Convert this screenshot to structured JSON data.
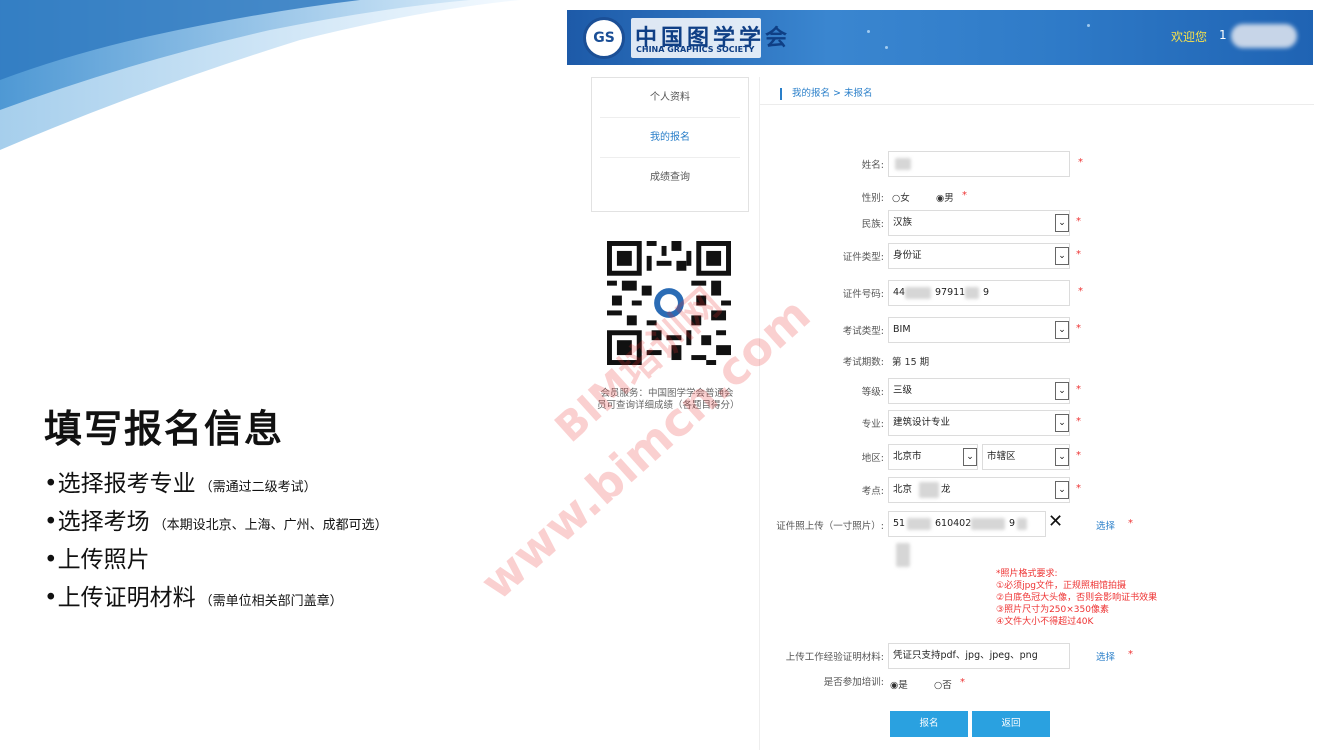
{
  "slide": {
    "title": "填写报名信息",
    "bullets": [
      {
        "text": "•选择报考专业",
        "note": "（需通过二级考试）"
      },
      {
        "text": "•选择考场",
        "note": "（本期设北京、上海、广州、成都可选）"
      },
      {
        "text": "•上传照片",
        "note": ""
      },
      {
        "text": "•上传证明材料",
        "note": "（需单位相关部门盖章）"
      }
    ]
  },
  "header": {
    "logo_cn": "中国图学学会",
    "logo_en": "CHINA GRAPHICS SOCIETY",
    "welcome": "欢迎您",
    "user_num": "1"
  },
  "sidebar": {
    "items": [
      "个人资料",
      "我的报名",
      "成绩查询"
    ],
    "qr_caption": "会员服务：中国图学学会普通会员可查询详细成绩（各题目得分）"
  },
  "breadcrumb": "我的报名 > 未报名",
  "form": {
    "name_label": "姓名:",
    "gender_label": "性别:",
    "gender_female": "○女",
    "gender_male": "◉男",
    "ethnic_label": "民族:",
    "ethnic_value": "汉族",
    "idtype_label": "证件类型:",
    "idtype_value": "身份证",
    "idnum_label": "证件号码:",
    "idnum_a": "44",
    "idnum_b": "97911",
    "idnum_c": "9",
    "examtype_label": "考试类型:",
    "examtype_value": "BIM",
    "period_label": "考试期数:",
    "period_value": "第 15 期",
    "level_label": "等级:",
    "level_value": "三级",
    "major_label": "专业:",
    "major_value": "建筑设计专业",
    "region_label": "地区:",
    "region_city": "北京市",
    "region_district": "市辖区",
    "site_label": "考点:",
    "site_a": "北京",
    "site_b": "龙",
    "photo_label": "证件照上传（一寸照片）:",
    "photo_a": "51",
    "photo_b": "610402",
    "photo_c": "9",
    "photo_clear": "✕",
    "select_label": "选择",
    "photo_req": [
      "*照片格式要求:",
      "①必须jpg文件，正规照相馆拍摄",
      "②白底色冠大头像，否则会影响证书效果",
      "③照片尺寸为250×350像素",
      "④文件大小不得超过40K"
    ],
    "proof_label": "上传工作经验证明材料:",
    "proof_hint": "凭证只支持pdf、jpg、jpeg、png",
    "train_label": "是否参加培训:",
    "train_yes": "◉是",
    "train_no": "○否",
    "star": "*",
    "submit": "报名",
    "back": "返回"
  },
  "watermark": {
    "line1": "BIM培训网",
    "line2": "www.bimcn.com"
  },
  "colors": {
    "accent": "#2a7fc9",
    "button": "#2aa1e0",
    "required": "#ee3333",
    "banner": "#2f7bc8"
  }
}
